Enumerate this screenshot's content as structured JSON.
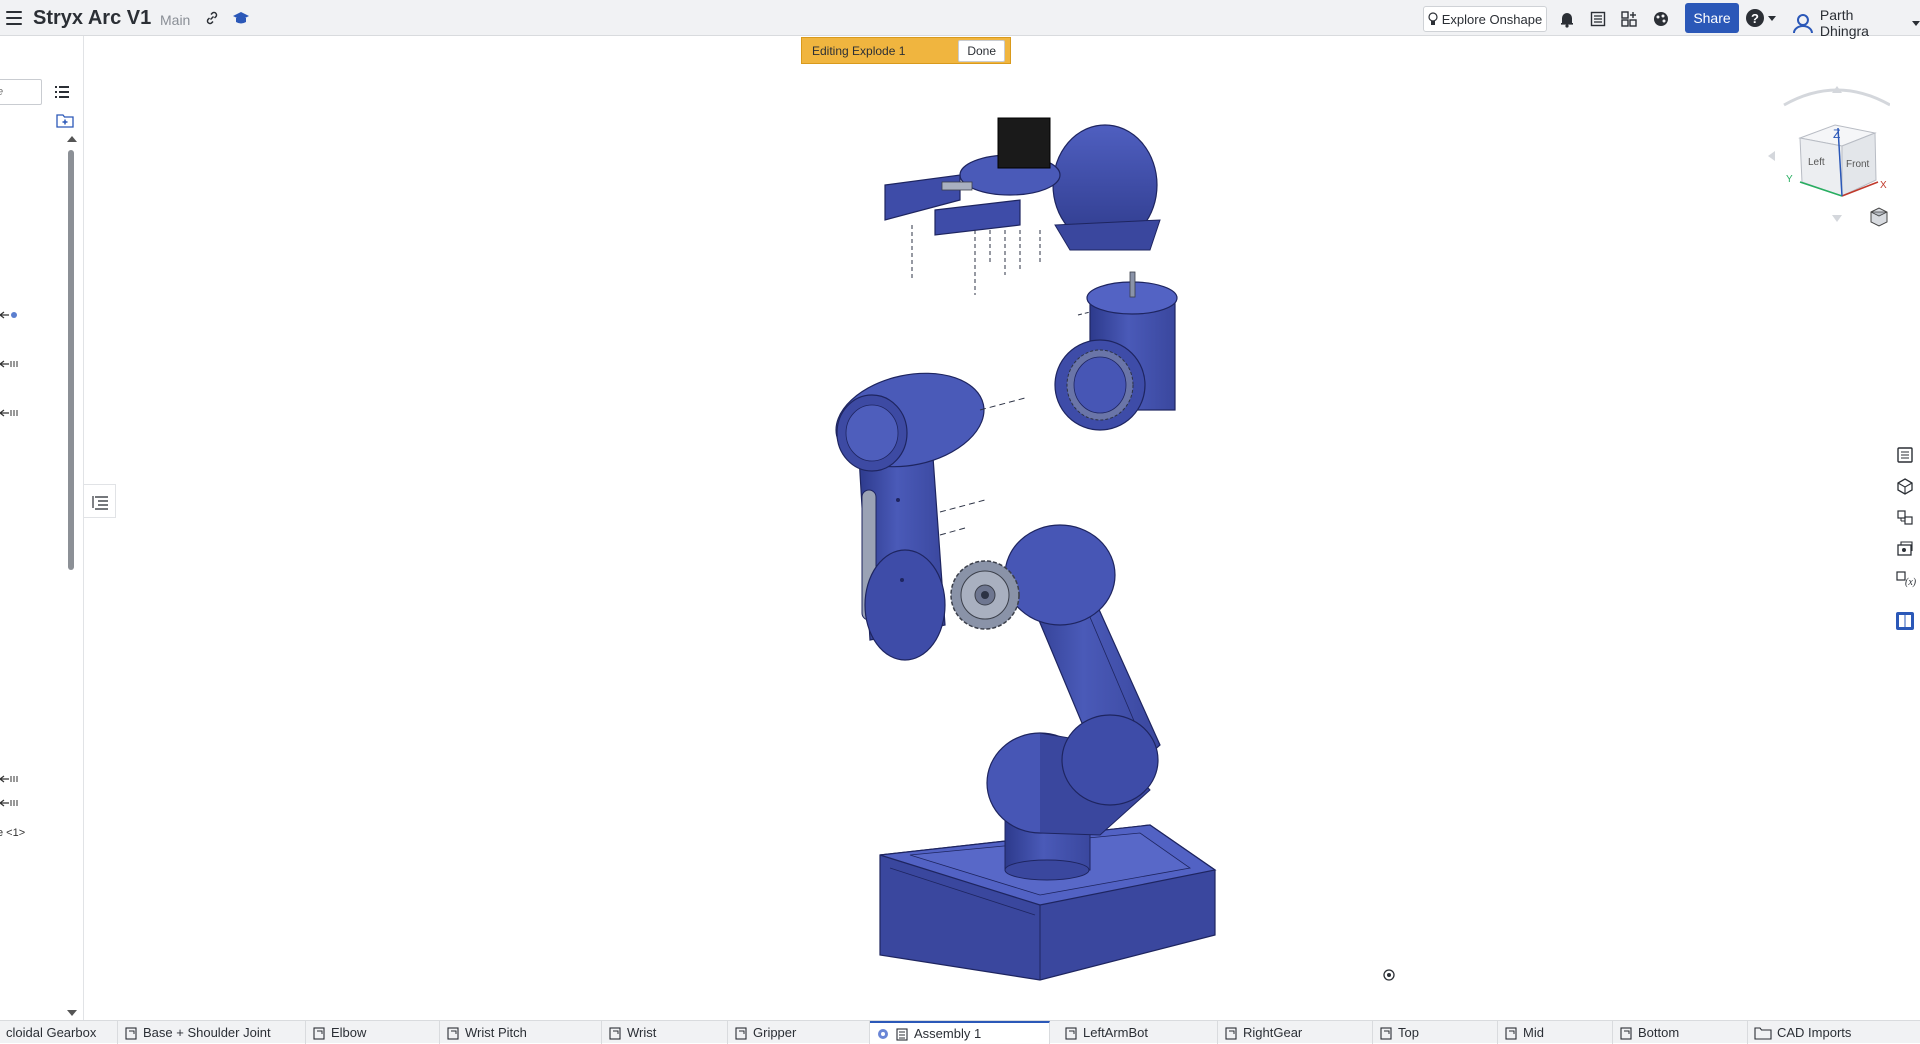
{
  "header": {
    "document_title": "Stryx Arc V1",
    "branch": "Main",
    "explore_label": "Explore Onshape",
    "share_label": "Share",
    "help_label": "?",
    "user_name": "Parth Dhingra"
  },
  "banner": {
    "text": "Editing Explode 1",
    "done_label": "Done"
  },
  "left_panel": {
    "filter_placeholder": "e",
    "instance_label": "e <1>"
  },
  "view_cube": {
    "face_top": "Z",
    "face_left": "Left",
    "face_front": "Front",
    "axis_x": "X",
    "axis_y": "Y"
  },
  "tabs": [
    {
      "label": "cloidal Gearbox",
      "icon": "part-studio-icon"
    },
    {
      "label": "Base + Shoulder Joint",
      "icon": "part-studio-icon"
    },
    {
      "label": "Elbow",
      "icon": "part-studio-icon"
    },
    {
      "label": "Wrist Pitch",
      "icon": "part-studio-icon"
    },
    {
      "label": "Wrist",
      "icon": "part-studio-icon"
    },
    {
      "label": "Gripper",
      "icon": "part-studio-icon"
    },
    {
      "label": "Assembly 1",
      "icon": "assembly-icon"
    },
    {
      "label": "LeftArmBot",
      "icon": "part-studio-icon"
    },
    {
      "label": "RightGear",
      "icon": "part-studio-icon"
    },
    {
      "label": "Top",
      "icon": "part-studio-icon"
    },
    {
      "label": "Mid",
      "icon": "part-studio-icon"
    },
    {
      "label": "Bottom",
      "icon": "part-studio-icon"
    },
    {
      "label": "CAD Imports",
      "icon": "folder-icon"
    }
  ],
  "colors": {
    "accent": "#2b58b8",
    "banner": "#f0b53f",
    "model_blue": "#4a58b0",
    "model_dark": "#2f3a86"
  }
}
